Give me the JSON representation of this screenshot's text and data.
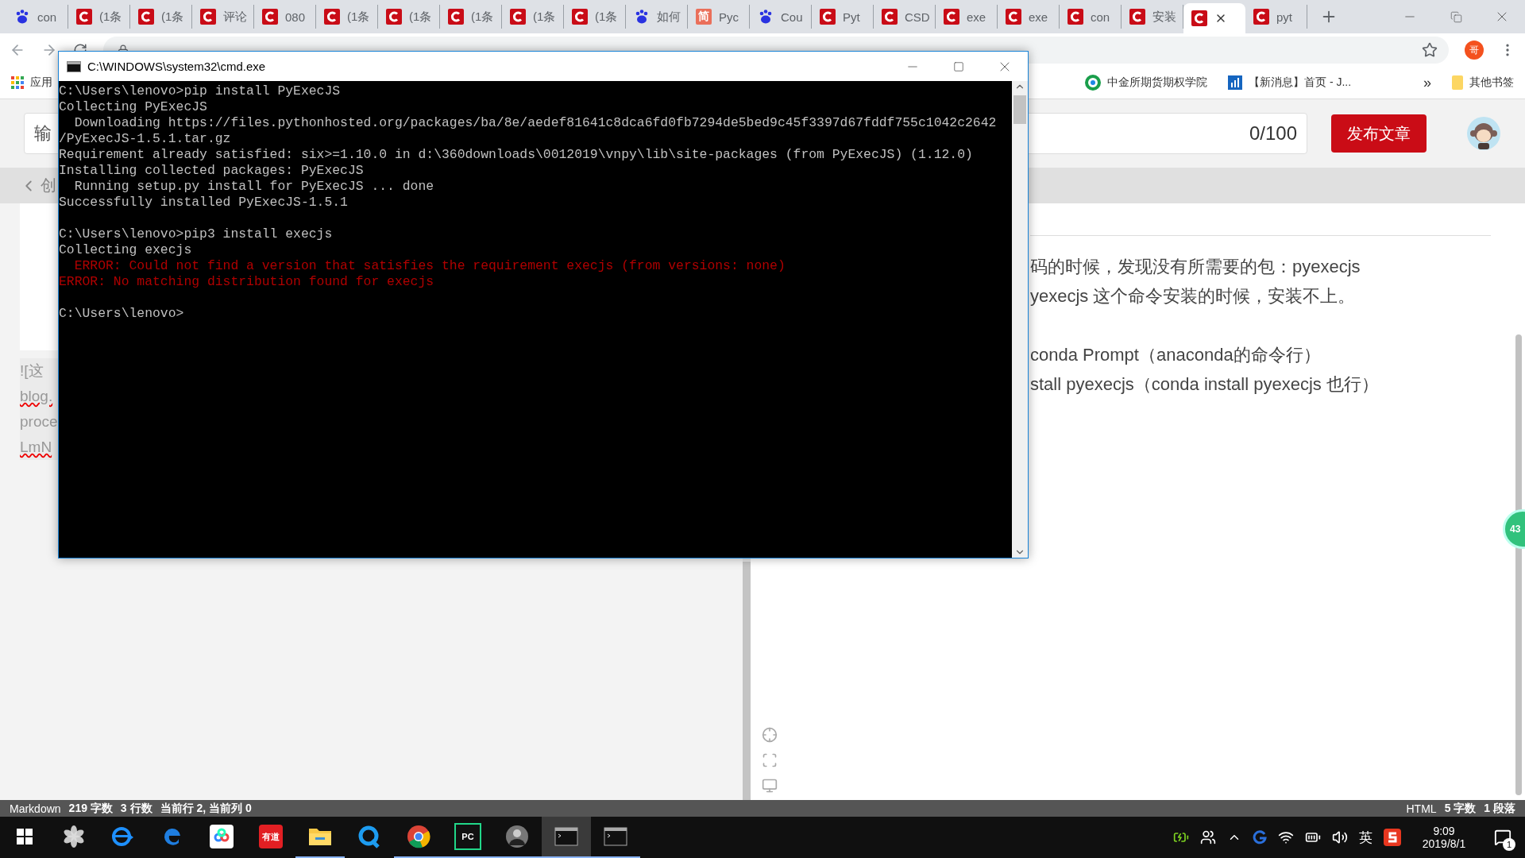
{
  "browser": {
    "tabs": [
      {
        "kind": "baidu",
        "label": "con",
        "selected": false
      },
      {
        "kind": "csdn",
        "label": "(1条",
        "selected": false
      },
      {
        "kind": "csdn",
        "label": "(1条",
        "selected": false
      },
      {
        "kind": "csdn",
        "label": "评论",
        "selected": false
      },
      {
        "kind": "csdn",
        "label": "080",
        "selected": false
      },
      {
        "kind": "csdn",
        "label": "(1条",
        "selected": false
      },
      {
        "kind": "csdn",
        "label": "(1条",
        "selected": false
      },
      {
        "kind": "csdn",
        "label": "(1条",
        "selected": false
      },
      {
        "kind": "csdn",
        "label": "(1条",
        "selected": false
      },
      {
        "kind": "csdn",
        "label": "(1条",
        "selected": false
      },
      {
        "kind": "baidu",
        "label": "如何",
        "selected": false
      },
      {
        "kind": "jianshu",
        "icon_text": "简",
        "label": "Pyc",
        "selected": false
      },
      {
        "kind": "baidu",
        "label": "Cou",
        "selected": false
      },
      {
        "kind": "csdn",
        "label": "Pyt",
        "selected": false
      },
      {
        "kind": "csdn",
        "label": "CSD",
        "selected": false
      },
      {
        "kind": "csdn",
        "label": "exe",
        "selected": false
      },
      {
        "kind": "csdn",
        "label": "exe",
        "selected": false
      },
      {
        "kind": "csdn",
        "label": "con",
        "selected": false
      },
      {
        "kind": "csdn",
        "label": "安装",
        "selected": false
      },
      {
        "kind": "csdn",
        "selected": true
      },
      {
        "kind": "csdn",
        "label": "pyt",
        "selected": false
      }
    ],
    "profile_initial": "哥",
    "bookmarks": [
      {
        "kind": "apps",
        "label": "应用"
      },
      {
        "kind": "ring",
        "label": "中金所期货期权学院"
      },
      {
        "kind": "chart",
        "label": "【新消息】首页 - J..."
      }
    ],
    "bookmarks_more": "»",
    "other_bookmarks": "其他书签"
  },
  "editor": {
    "title_placeholder": "输",
    "title_counter": "0/100",
    "publish_button": "发布文章",
    "back_link": "创",
    "left_fragments": [
      {
        "text": "![这",
        "misspelled": false
      },
      {
        "text": "blog.",
        "misspelled": true
      },
      {
        "text": "proce",
        "misspelled": false
      },
      {
        "text": "LmN",
        "misspelled": true
      }
    ],
    "preview_lines": [
      {
        "kind": "text",
        "text": "码的时候，发现没有所需要的包：pyexecjs"
      },
      {
        "kind": "text",
        "text": "yexecjs 这个命令安装的时候，安装不上。"
      },
      {
        "kind": "gap"
      },
      {
        "kind": "text",
        "text": "conda Prompt（anaconda的命令行）"
      },
      {
        "kind": "text",
        "text": "stall pyexecjs（conda install pyexecjs 也行）"
      }
    ],
    "side_badge": "43"
  },
  "status_bar": {
    "left": [
      {
        "kind": "mode",
        "text": "Markdown"
      },
      {
        "kind": "count",
        "text": "219 字数"
      },
      {
        "kind": "count",
        "text": "3 行数"
      },
      {
        "kind": "count",
        "text": "当前行 2, 当前列 0"
      }
    ],
    "right": [
      {
        "kind": "mode",
        "text": "HTML"
      },
      {
        "kind": "count",
        "text": "5 字数"
      },
      {
        "kind": "count",
        "text": "1 段落"
      }
    ]
  },
  "cmd": {
    "title": "C:\\WINDOWS\\system32\\cmd.exe",
    "lines": [
      {
        "kind": "normal",
        "text": "C:\\Users\\lenovo>pip install PyExecJS"
      },
      {
        "kind": "normal",
        "text": "Collecting PyExecJS"
      },
      {
        "kind": "normal",
        "text": "  Downloading https://files.pythonhosted.org/packages/ba/8e/aedef81641c8dca6fd0fb7294de5bed9c45f3397d67fddf755c1042c2642"
      },
      {
        "kind": "normal",
        "text": "/PyExecJS-1.5.1.tar.gz"
      },
      {
        "kind": "normal",
        "text": "Requirement already satisfied: six>=1.10.0 in d:\\360downloads\\0012019\\vnpy\\lib\\site-packages (from PyExecJS) (1.12.0)"
      },
      {
        "kind": "normal",
        "text": "Installing collected packages: PyExecJS"
      },
      {
        "kind": "normal",
        "text": "  Running setup.py install for PyExecJS ... done"
      },
      {
        "kind": "normal",
        "text": "Successfully installed PyExecJS-1.5.1"
      },
      {
        "kind": "blank"
      },
      {
        "kind": "normal",
        "text": "C:\\Users\\lenovo>pip3 install execjs"
      },
      {
        "kind": "normal",
        "text": "Collecting execjs"
      },
      {
        "kind": "error",
        "text": "  ERROR: Could not find a version that satisfies the requirement execjs (from versions: none)"
      },
      {
        "kind": "error",
        "text": "ERROR: No matching distribution found for execjs"
      },
      {
        "kind": "blank"
      },
      {
        "kind": "normal",
        "text": "C:\\Users\\lenovo>"
      }
    ]
  },
  "taskbar": {
    "apps": [
      {
        "kind": "swirl",
        "running": false,
        "active": false
      },
      {
        "kind": "ie",
        "running": false,
        "active": false
      },
      {
        "kind": "edge",
        "running": false,
        "active": false
      },
      {
        "kind": "cloud",
        "running": false,
        "active": false
      },
      {
        "kind": "youdao",
        "icon_text": "有道",
        "running": false,
        "active": false
      },
      {
        "kind": "folder",
        "running": true,
        "active": false
      },
      {
        "kind": "qq",
        "running": false,
        "active": false
      },
      {
        "kind": "chrome",
        "running": true,
        "active": false
      },
      {
        "kind": "pycharm",
        "icon_text": "PC",
        "running": true,
        "active": false
      },
      {
        "kind": "photo",
        "running": true,
        "active": false
      },
      {
        "kind": "console",
        "running": true,
        "active": true
      },
      {
        "kind": "console",
        "running": true,
        "active": false
      }
    ],
    "ime": "英",
    "time": "9:09",
    "date": "2019/8/1",
    "notifications": "1"
  }
}
